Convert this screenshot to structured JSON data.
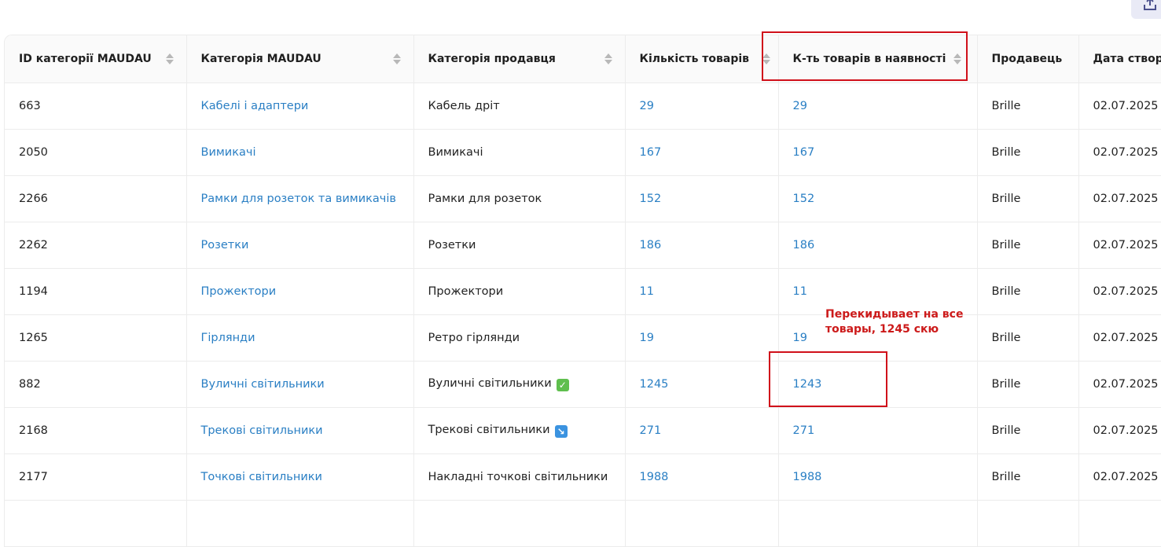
{
  "table": {
    "headers": [
      "ID категорії MAUDAU",
      "Категорія MAUDAU",
      "Категорія продавця",
      "Кількість товарів",
      "К-ть товарів в наявності",
      "Продавець",
      "Дата створе"
    ],
    "rows": [
      {
        "id": "663",
        "maudau": "Кабелі і адаптери",
        "seller_cat": "Кабель дріт",
        "count": "29",
        "stock": "29",
        "seller": "Brille",
        "date": "02.07.2025"
      },
      {
        "id": "2050",
        "maudau": "Вимикачі",
        "seller_cat": "Вимикачі",
        "count": "167",
        "stock": "167",
        "seller": "Brille",
        "date": "02.07.2025"
      },
      {
        "id": "2266",
        "maudau": "Рамки для розеток та вимикачів",
        "seller_cat": "Рамки для розеток",
        "count": "152",
        "stock": "152",
        "seller": "Brille",
        "date": "02.07.2025"
      },
      {
        "id": "2262",
        "maudau": "Розетки",
        "seller_cat": "Розетки",
        "count": "186",
        "stock": "186",
        "seller": "Brille",
        "date": "02.07.2025"
      },
      {
        "id": "1194",
        "maudau": "Прожектори",
        "seller_cat": "Прожектори",
        "count": "11",
        "stock": "11",
        "seller": "Brille",
        "date": "02.07.2025"
      },
      {
        "id": "1265",
        "maudau": "Гірлянди",
        "seller_cat": "Ретро гірлянди",
        "count": "19",
        "stock": "19",
        "seller": "Brille",
        "date": "02.07.2025"
      },
      {
        "id": "882",
        "maudau": "Вуличні світильники",
        "seller_cat": "Вуличні світильники",
        "count": "1245",
        "stock": "1243",
        "seller": "Brille",
        "date": "02.07.2025"
      },
      {
        "id": "2168",
        "maudau": "Трекові світильники",
        "seller_cat": "Трекові світильники",
        "count": "271",
        "stock": "271",
        "seller": "Brille",
        "date": "02.07.2025"
      },
      {
        "id": "2177",
        "maudau": "Точкові світильники",
        "seller_cat": "Накладні точкові світильники",
        "count": "1988",
        "stock": "1988",
        "seller": "Brille",
        "date": "02.07.2025"
      }
    ]
  },
  "annotation": {
    "line1": "Перекидывает на все",
    "line2": "товары, 1245 скю"
  },
  "icons": {
    "export": "upload-icon",
    "sort": "sort-icon",
    "check": "check-mark-icon",
    "arrow": "arrow-down-right-icon"
  },
  "colors": {
    "link": "#2a7fc4",
    "annotation": "#d0101a",
    "header_bg": "#fafafa"
  }
}
